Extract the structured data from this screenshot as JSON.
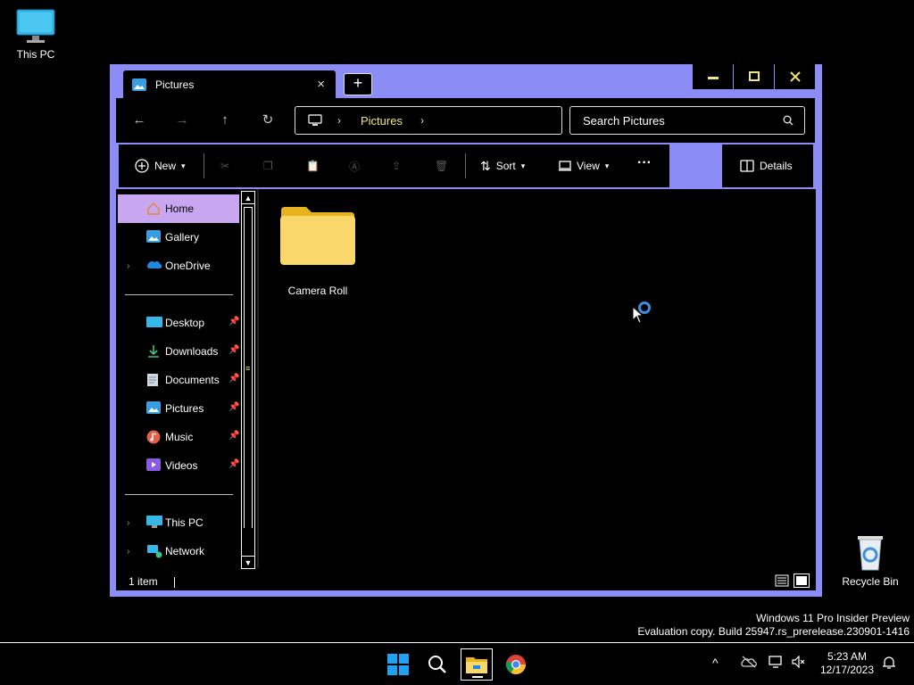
{
  "desktop": {
    "this_pc_label": "This PC",
    "recycle_bin_label": "Recycle Bin"
  },
  "window": {
    "tab_title": "Pictures",
    "tab_close": "×",
    "new_tab": "+",
    "controls": {
      "minimize": "—",
      "maximize": "☐",
      "close": "✕"
    }
  },
  "navbar": {
    "back": "←",
    "forward": "→",
    "up": "↑",
    "refresh": "↻",
    "breadcrumb": "Pictures",
    "search_placeholder": "Search Pictures"
  },
  "commands": {
    "new": "New",
    "sort": "Sort",
    "view": "View",
    "more": "···",
    "details": "Details"
  },
  "sidebar": {
    "items": [
      {
        "label": "Home",
        "icon": "home-icon",
        "selected": true
      },
      {
        "label": "Gallery",
        "icon": "gallery-icon"
      },
      {
        "label": "OneDrive",
        "icon": "onedrive-icon",
        "expandable": true
      },
      {
        "label": "Desktop",
        "icon": "desktop-icon",
        "pinned": true
      },
      {
        "label": "Downloads",
        "icon": "downloads-icon",
        "pinned": true
      },
      {
        "label": "Documents",
        "icon": "documents-icon",
        "pinned": true
      },
      {
        "label": "Pictures",
        "icon": "pictures-icon",
        "pinned": true
      },
      {
        "label": "Music",
        "icon": "music-icon",
        "pinned": true
      },
      {
        "label": "Videos",
        "icon": "videos-icon",
        "pinned": true
      },
      {
        "label": "This PC",
        "icon": "this-pc-icon",
        "expandable": true
      },
      {
        "label": "Network",
        "icon": "network-icon",
        "expandable": true
      }
    ]
  },
  "files": [
    {
      "name": "Camera Roll",
      "type": "folder"
    }
  ],
  "status": {
    "item_count": "1 item"
  },
  "watermark": {
    "line1": "Windows 11 Pro Insider Preview",
    "line2": "Evaluation copy. Build 25947.rs_prerelease.230901-1416"
  },
  "taskbar": {
    "time": "5:23 AM",
    "date": "12/17/2023"
  },
  "colors": {
    "window_frame": "#8c8cf6",
    "selection": "#c8a6f0",
    "link_yellow": "#f0e87a",
    "folder_yellow": "#f7d35b"
  }
}
